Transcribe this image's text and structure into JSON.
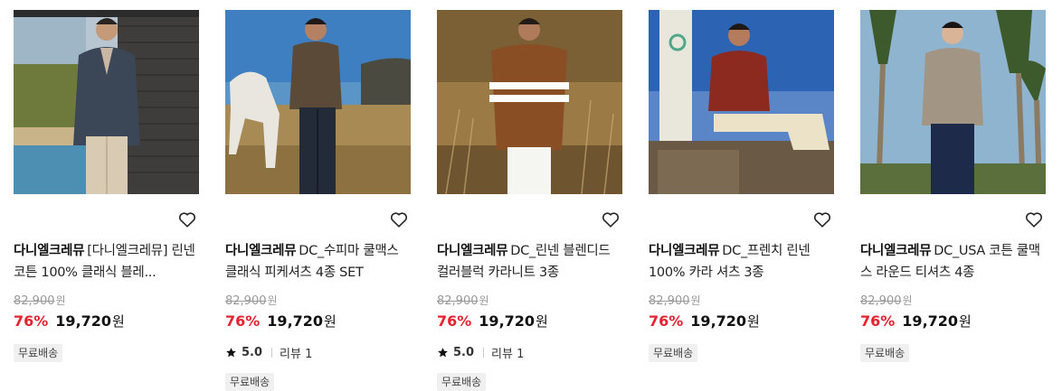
{
  "products": [
    {
      "brand": "다니엘크레뮤",
      "name": "[다니엘크레뮤] 린넨 코튼 100% 클래식 블레...",
      "original_price": "82,900",
      "original_unit": "원",
      "discount": "76%",
      "sale_price": "19,720",
      "sale_unit": "원",
      "rating": null,
      "reviews": null,
      "badge": "무료배송",
      "image": "man-in-navy-blazer-by-brick-wall"
    },
    {
      "brand": "다니엘크레뮤",
      "name": "DC_수피마 쿨맥스 클래식 피케셔츠 4종 SET",
      "original_price": "82,900",
      "original_unit": "원",
      "discount": "76%",
      "sale_price": "19,720",
      "sale_unit": "원",
      "rating": "5.0",
      "reviews": "리뷰 1",
      "badge": "무료배송",
      "image": "man-in-brown-polo-with-white-horse"
    },
    {
      "brand": "다니엘크레뮤",
      "name": "DC_린넨 블렌디드 컬러블럭 카라니트 3종",
      "original_price": "82,900",
      "original_unit": "원",
      "discount": "76%",
      "sale_price": "19,720",
      "sale_unit": "원",
      "rating": "5.0",
      "reviews": "리뷰 1",
      "badge": "무료배송",
      "image": "man-in-brown-striped-knit-polo-in-field"
    },
    {
      "brand": "다니엘크레뮤",
      "name": "DC_프렌치 린넨 100% 카라 셔츠 3종",
      "original_price": "82,900",
      "original_unit": "원",
      "discount": "76%",
      "sale_price": "19,720",
      "sale_unit": "원",
      "rating": null,
      "reviews": null,
      "badge": "무료배송",
      "image": "man-in-red-shirt-sitting-on-rocks"
    },
    {
      "brand": "다니엘크레뮤",
      "name": "DC_USA 코튼 쿨맥스 라운드 티셔츠 4종",
      "original_price": "82,900",
      "original_unit": "원",
      "discount": "76%",
      "sale_price": "19,720",
      "sale_unit": "원",
      "rating": null,
      "reviews": null,
      "badge": "무료배송",
      "image": "man-in-grey-tee-under-palm-trees"
    }
  ],
  "icons": {
    "wishlist": "heart-outline-icon",
    "rating": "star-icon"
  },
  "colors": {
    "discount": "#e5222f",
    "badge_bg": "#f0f0f0",
    "strike": "#999999"
  }
}
